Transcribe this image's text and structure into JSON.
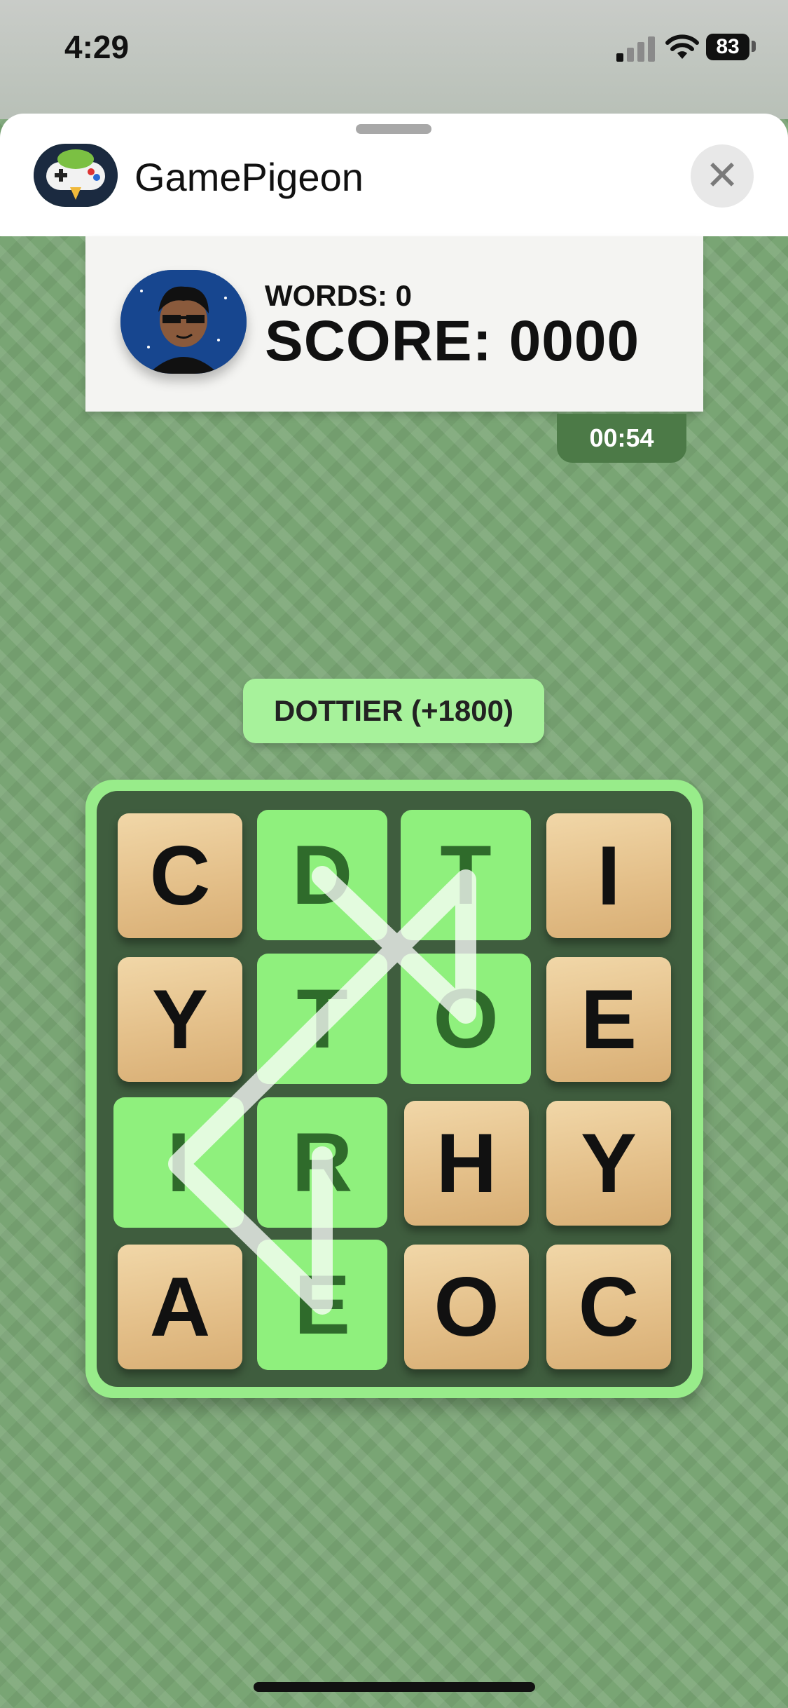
{
  "status_bar": {
    "time": "4:29",
    "battery": "83"
  },
  "header": {
    "app_name": "GamePigeon",
    "close_glyph": "✕"
  },
  "score_card": {
    "words_label": "WORDS: 0",
    "score_label": "SCORE: 0000"
  },
  "timer": "00:54",
  "last_word": "DOTTIER (+1800)",
  "board": {
    "rows": [
      [
        "C",
        "D",
        "T",
        "I"
      ],
      [
        "Y",
        "T",
        "O",
        "E"
      ],
      [
        "I",
        "R",
        "H",
        "Y"
      ],
      [
        "A",
        "E",
        "O",
        "C"
      ]
    ],
    "selected_cells": [
      "0-1",
      "0-2",
      "1-1",
      "1-2",
      "2-0",
      "2-1",
      "3-1"
    ]
  },
  "colors": {
    "background": "#79a574",
    "tile_wood": "#e4c08a",
    "tile_selected": "#8ff07d",
    "board_border": "#98ec8a",
    "board_inner": "#3f5d3e",
    "timer_bg": "#4c7a47"
  },
  "icons": {
    "app_logo": "gamepigeon-logo-icon",
    "close": "close-icon",
    "signal": "signal-icon",
    "wifi": "wifi-icon",
    "battery": "battery-icon",
    "avatar": "avatar-icon"
  }
}
